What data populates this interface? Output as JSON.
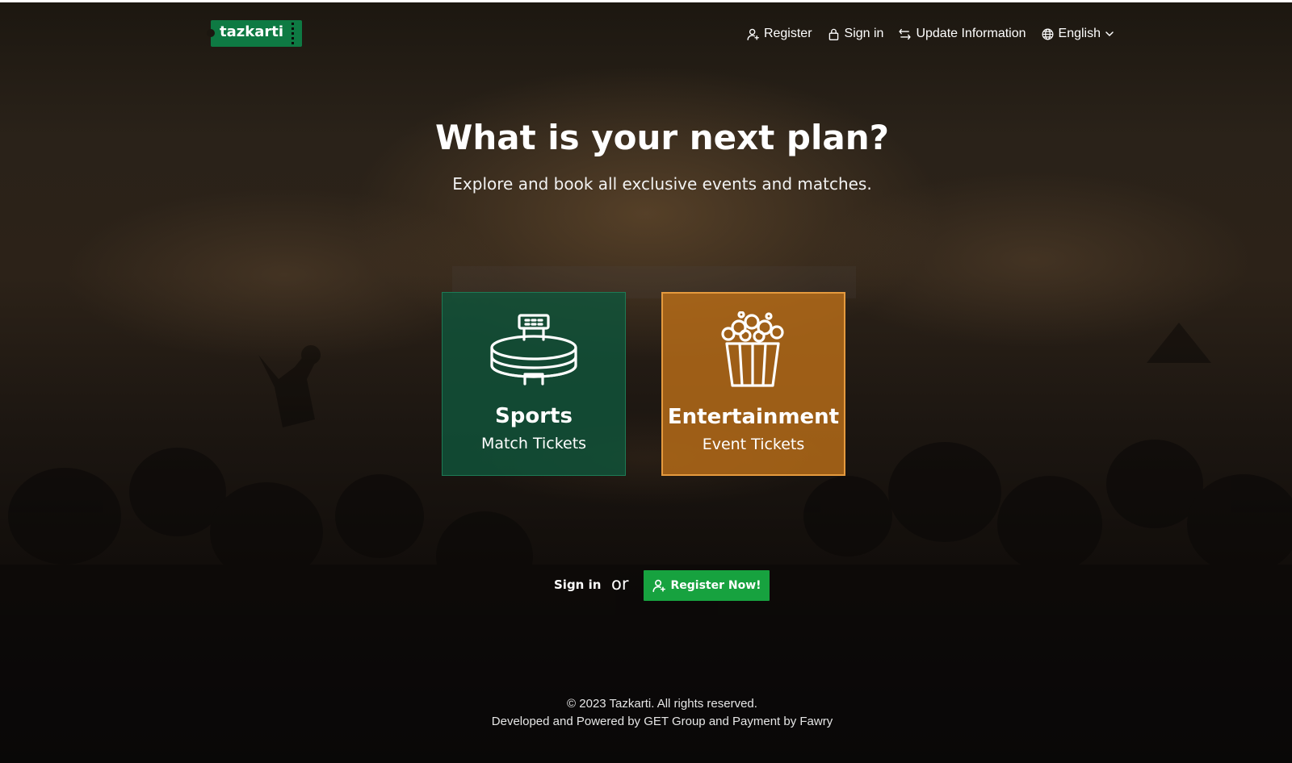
{
  "brand": {
    "logo_text": "tazkarti",
    "primary_color": "#0e7a43",
    "button_color": "#17a23f"
  },
  "nav": {
    "items": [
      {
        "label": "Register",
        "icon": "user-plus-icon"
      },
      {
        "label": "Sign in",
        "icon": "lock-icon"
      },
      {
        "label": "Update Information",
        "icon": "swap-arrows-icon"
      },
      {
        "label": "English",
        "icon": "globe-icon",
        "dropdown_icon": "chevron-down-icon"
      }
    ]
  },
  "hero": {
    "title": "What is your next plan?",
    "subtitle": "Explore and book all exclusive events and matches."
  },
  "cards": [
    {
      "title": "Sports",
      "subtitle": "Match Tickets",
      "icon": "stadium-icon",
      "color": "#10543a"
    },
    {
      "title": "Entertainment",
      "subtitle": "Event Tickets",
      "icon": "popcorn-icon",
      "color": "#ba6e18"
    }
  ],
  "auth": {
    "signin_label": "Sign in",
    "or_label": "or",
    "register_label": "Register Now!",
    "register_icon": "user-plus-icon"
  },
  "footer": {
    "copyright": "© 2023 Tazkarti. All rights reserved.",
    "developed": "Developed and Powered by GET Group and Payment by Fawry"
  }
}
